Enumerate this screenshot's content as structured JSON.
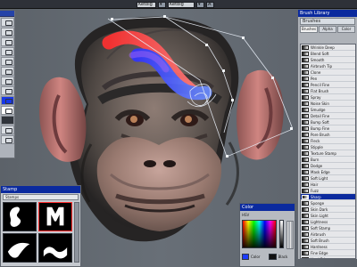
{
  "topbar": {
    "fields": [
      "Ketbig",
      "Ketbig",
      "A"
    ]
  },
  "face": {
    "label": ""
  },
  "right_panel": {
    "title": "Brush Library",
    "selected_label": "Brushes",
    "tabs": [
      "Brushes",
      "Alpha",
      "Color"
    ],
    "items": [
      "Wrinkle Deep",
      "Blend Soft",
      "Smooth",
      "Airbrush Tip",
      "Clone",
      "Pen",
      "Pencil Fine",
      "Flat Brush",
      "Spray",
      "Noise Skin",
      "Smudge",
      "Detail Fine",
      "Bump Soft",
      "Bump Fine",
      "Pore Brush",
      "Fleck",
      "Stipple",
      "Texture Stamp",
      "Burn",
      "Dodge",
      "Mask Edge",
      "Soft Light",
      "Hair",
      "Fuzz",
      "Sharp",
      "Sponge",
      "Skin Dark",
      "Skin Light",
      "Lightness",
      "Soft Stamp",
      "Airbrush",
      "Soft Brush",
      "Hardness",
      "Fine Edge",
      "Hard Edge"
    ],
    "selected_index": 24
  },
  "bottom_left": {
    "title": "Stamp",
    "path": "Stamps"
  },
  "color_panel": {
    "title": "Color",
    "mode": "HSV",
    "primary_label": "Color",
    "secondary_label": "Black"
  }
}
